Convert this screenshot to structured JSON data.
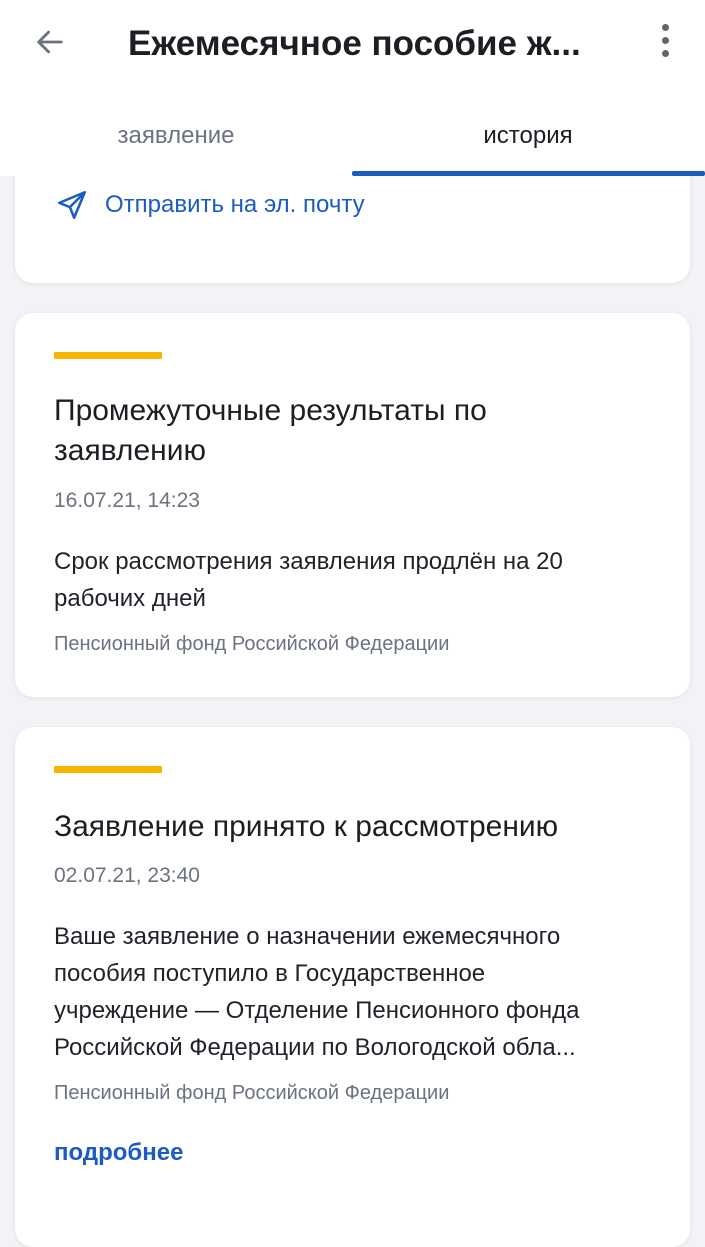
{
  "header": {
    "title": "Ежемесячное пособие ж...",
    "back_icon": "arrow-left-icon",
    "menu_icon": "more-vertical-icon"
  },
  "tabs": [
    {
      "label": "заявление",
      "active": false
    },
    {
      "label": "история",
      "active": true
    }
  ],
  "colors": {
    "accent_bar": "#f7b500",
    "link": "#1b5bc4",
    "tab_indicator": "#1b5bc4"
  },
  "top_card": {
    "send_email_label": "Отправить на эл. почту",
    "send_icon": "send-icon"
  },
  "history": [
    {
      "title_line1": "Промежуточные результаты по",
      "title_line2": "заявлению",
      "date": "16.07.21, 14:23",
      "text_line1": "Срок рассмотрения заявления продлён на 20",
      "text_line2": "рабочих дней",
      "source": "Пенсионный фонд Российской Федерации"
    },
    {
      "title": "Заявление принято к рассмотрению",
      "date": "02.07.21, 23:40",
      "text_line1": "Ваше заявление о назначении ежемесячного",
      "text_line2": "пособия поступило в Государственное",
      "text_line3": "учреждение — Отделение Пенсионного фонда",
      "text_line4": "Российской Федерации по Вологодской обла...",
      "source": "Пенсионный фонд Российской Федерации",
      "more_label": "подробнее"
    }
  ]
}
